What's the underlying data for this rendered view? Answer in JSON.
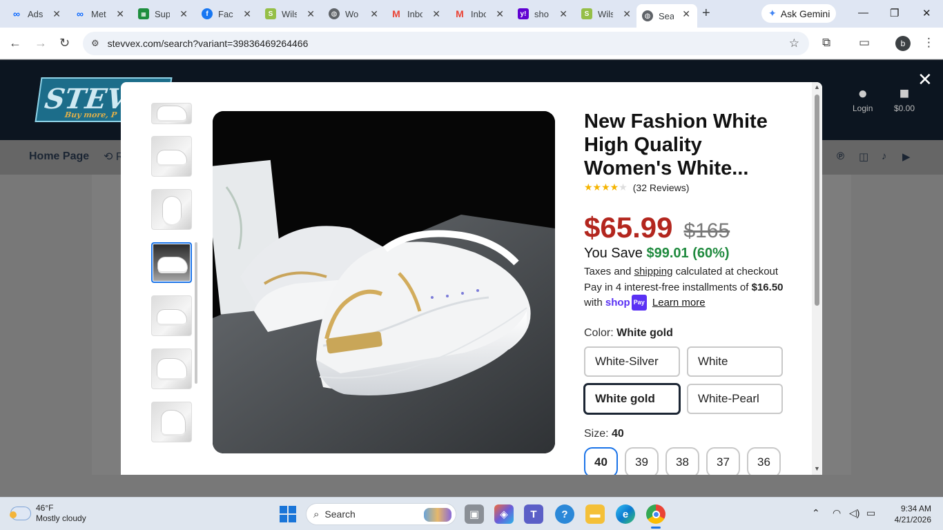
{
  "browser": {
    "tabs": [
      {
        "title": "Ads",
        "icon": "meta-icon",
        "color": "#0866ff"
      },
      {
        "title": "Met",
        "icon": "meta-icon",
        "color": "#0866ff"
      },
      {
        "title": "Sup",
        "icon": "spreadsheet-icon",
        "color": "#1e8e3e"
      },
      {
        "title": "Face",
        "icon": "facebook-icon",
        "color": "#1877f2"
      },
      {
        "title": "Wils",
        "icon": "shopify-icon",
        "color": "#95bf47"
      },
      {
        "title": "Wo",
        "icon": "globe-icon",
        "color": "#5f6368"
      },
      {
        "title": "Inbo",
        "icon": "gmail-icon",
        "color": "#ea4335"
      },
      {
        "title": "Inbo",
        "icon": "gmail-icon",
        "color": "#ea4335"
      },
      {
        "title": "sho",
        "icon": "yahoo-icon",
        "color": "#6001d2"
      },
      {
        "title": "Wils",
        "icon": "shopify-icon",
        "color": "#95bf47"
      },
      {
        "title": "Sea",
        "icon": "globe-icon",
        "color": "#5f6368"
      }
    ],
    "gemini_label": "Ask Gemini",
    "url": "stevvex.com/search?variant=39836469264466",
    "profile_initial": "b"
  },
  "site": {
    "logo_text": "STEVV",
    "logo_tagline": "Buy more, P",
    "login_label": "Login",
    "cart_total": "$0.00",
    "nav_home": "Home Page",
    "nav_history": "R"
  },
  "product": {
    "title": "New Fashion White High Quality Women's White...",
    "reviews": "(32 Reviews)",
    "rating": 4,
    "price": "$65.99",
    "compare_price": "$165",
    "save_prefix": "You Save",
    "save_amount": "$99.01 (60%)",
    "tax_prefix": "Taxes and",
    "tax_link": "shipping",
    "tax_suffix": "calculated at checkout",
    "installment_text": "Pay in 4 interest-free installments of",
    "installment_amount": "$16.50",
    "installment_with": "with",
    "shoppay_label": "shop",
    "shoppay_pay": "Pay",
    "learn_more": "Learn more",
    "color_label": "Color:",
    "color_selected": "White gold",
    "colors": [
      "White-Silver",
      "White",
      "White gold",
      "White-Pearl"
    ],
    "size_label": "Size:",
    "size_selected": "40",
    "sizes": [
      "40",
      "39",
      "38",
      "37",
      "36"
    ]
  },
  "taskbar": {
    "temp": "46°F",
    "condition": "Mostly cloudy",
    "search_placeholder": "Search",
    "time": "9:34 AM",
    "date": "4/21/2026"
  }
}
